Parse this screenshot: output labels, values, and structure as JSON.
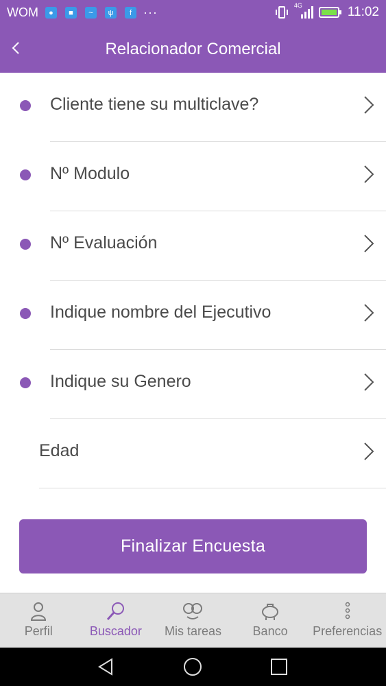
{
  "status_bar": {
    "carrier": "WOM",
    "overflow": "···",
    "network": "4G",
    "time": "11:02"
  },
  "header": {
    "title": "Relacionador Comercial"
  },
  "questions": [
    {
      "label": "Cliente tiene su multiclave?",
      "answered": true
    },
    {
      "label": "Nº Modulo",
      "answered": true
    },
    {
      "label": "Nº Evaluación",
      "answered": true
    },
    {
      "label": "Indique nombre del Ejecutivo",
      "answered": true
    },
    {
      "label": "Indique su Genero",
      "answered": true
    },
    {
      "label": "Edad",
      "answered": false
    }
  ],
  "actions": {
    "finalize_label": "Finalizar Encuesta"
  },
  "tabs": [
    {
      "label": "Perfil",
      "icon": "person-icon",
      "active": false
    },
    {
      "label": "Buscador",
      "icon": "magnifier-icon",
      "active": true
    },
    {
      "label": "Mis tareas",
      "icon": "tasks-icon",
      "active": false
    },
    {
      "label": "Banco",
      "icon": "piggy-bank-icon",
      "active": false
    },
    {
      "label": "Preferencias",
      "icon": "more-vertical-icon",
      "active": false
    }
  ],
  "colors": {
    "accent": "#8b58b6",
    "tab_bar": "#e2e2e2",
    "text": "#4a4a4a"
  }
}
